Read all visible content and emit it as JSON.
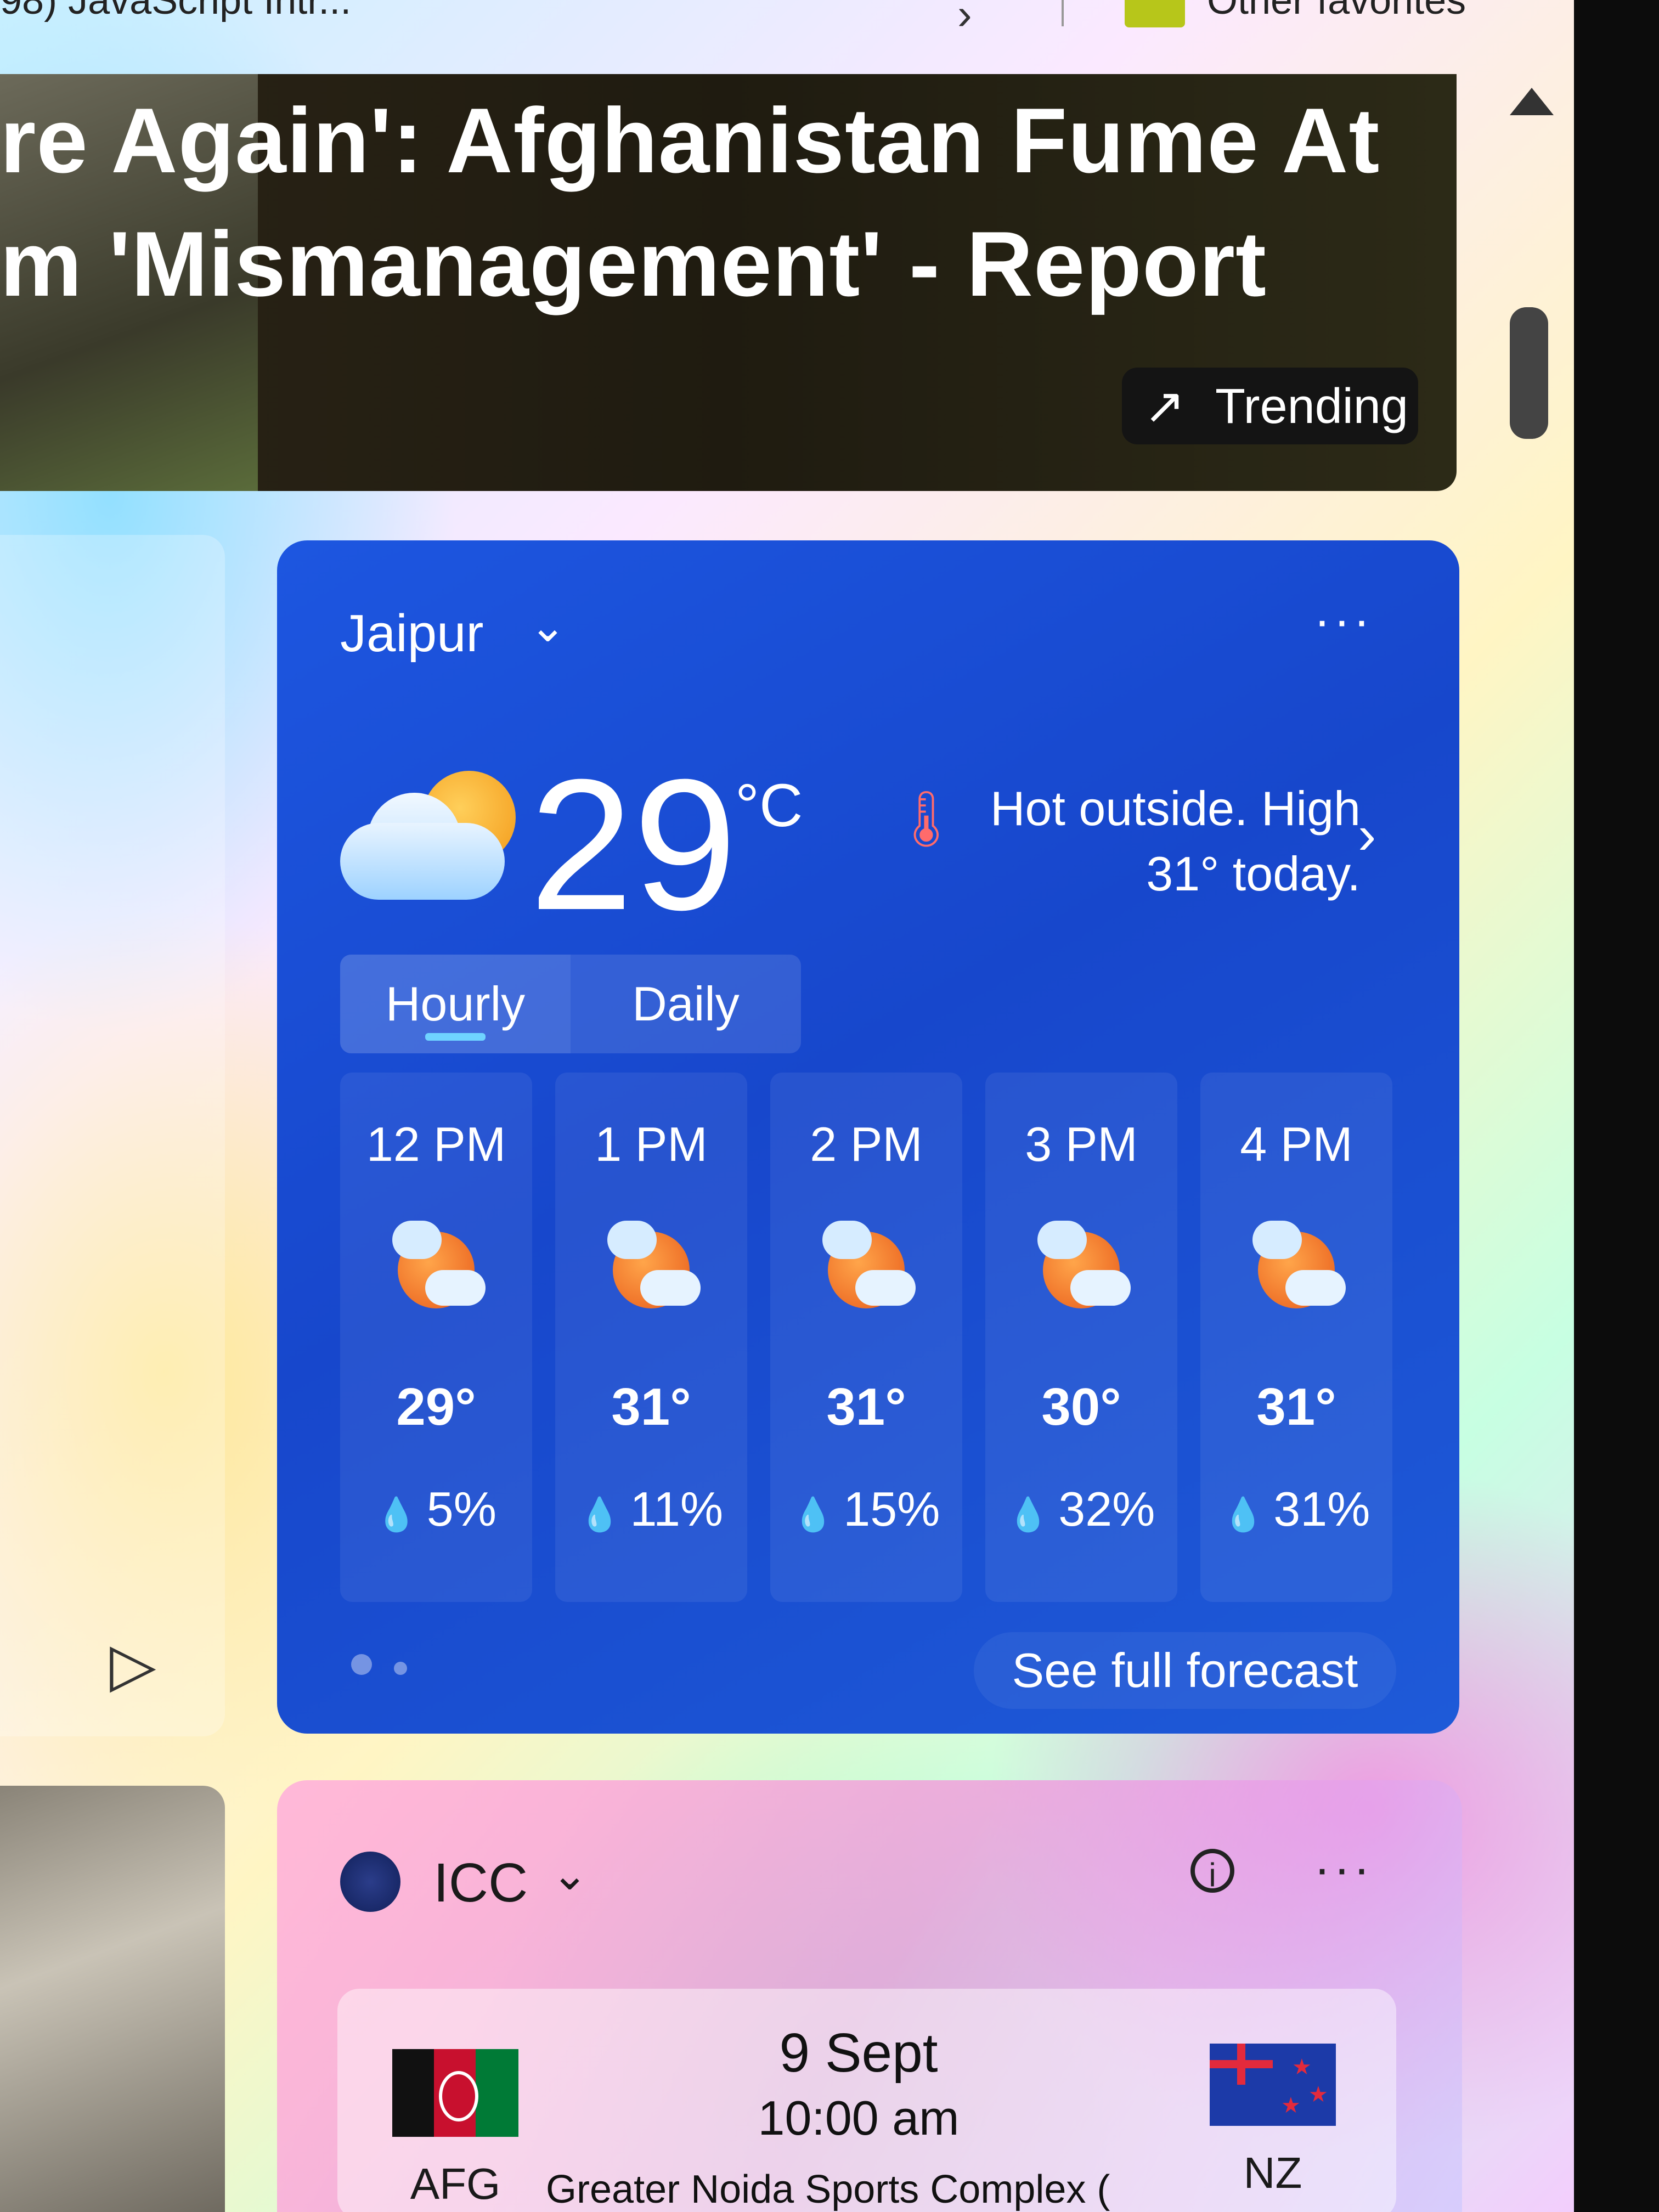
{
  "favorites_bar": {
    "left_item": "98) JavaScript Intr...",
    "other_favorites": "Other favorites"
  },
  "headline": {
    "line1": "re Again': Afghanistan Fume At",
    "line2": "m 'Mismanagement' - Report",
    "badge_icon": "trending-up-icon",
    "badge_label": "Trending"
  },
  "weather": {
    "city": "Jaipur",
    "temperature": "29",
    "unit": "°C",
    "summary": "Hot outside. High 31° today.",
    "tabs": {
      "hourly": "Hourly",
      "daily": "Daily",
      "active": "hourly"
    },
    "hours": [
      {
        "time": "12 PM",
        "temp": "29°",
        "precip": "5%"
      },
      {
        "time": "1 PM",
        "temp": "31°",
        "precip": "11%"
      },
      {
        "time": "2 PM",
        "temp": "31°",
        "precip": "15%"
      },
      {
        "time": "3 PM",
        "temp": "30°",
        "precip": "32%"
      },
      {
        "time": "4 PM",
        "temp": "31°",
        "precip": "31%"
      }
    ],
    "forecast_button": "See full forecast"
  },
  "cricket": {
    "title": "ICC",
    "match": {
      "team1": "AFG",
      "team2": "NZ",
      "date": "9 Sept",
      "time": "10:00 am",
      "venue": "Greater Noida Sports Complex ("
    }
  },
  "colors": {
    "weather_card": "#1747cc",
    "sun": "#f39a1a",
    "accent": "#6fd3ff"
  }
}
